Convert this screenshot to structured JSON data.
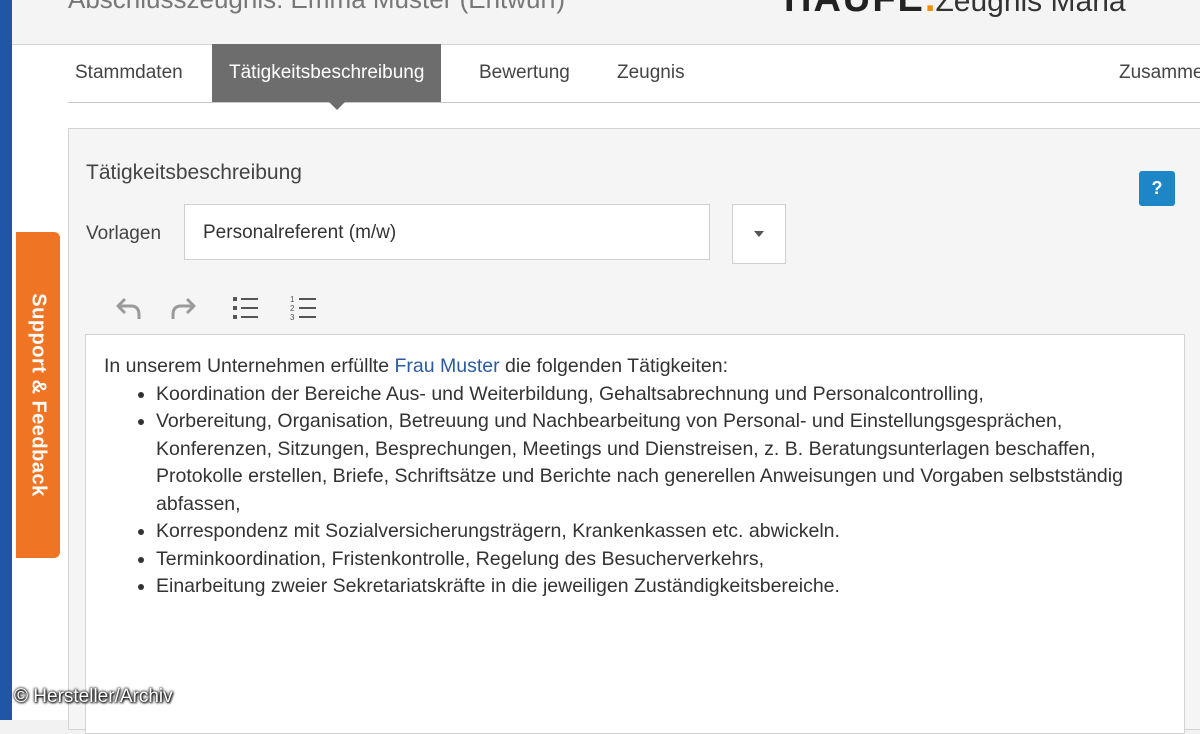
{
  "header": {
    "document_title": "Abschlusszeugnis: Emma Muster (Entwurf)",
    "brand_strong": "HAUFE",
    "brand_dot": ".",
    "brand_sub": "Zeugnis Mana"
  },
  "tabs": [
    {
      "label": "Stammdaten",
      "active": false
    },
    {
      "label": "Tätigkeitsbeschreibung",
      "active": true
    },
    {
      "label": "Bewertung",
      "active": false
    },
    {
      "label": "Zeugnis",
      "active": false
    },
    {
      "label": "Zusamme",
      "active": false
    }
  ],
  "panel": {
    "title": "Tätigkeitsbeschreibung",
    "help_label": "?",
    "vorlagen_label": "Vorlagen",
    "vorlagen_value": "Personalreferent (m/w)"
  },
  "toolbar": {
    "icons": [
      "undo-icon",
      "redo-icon",
      "bullet-list-icon",
      "numbered-list-icon"
    ]
  },
  "editor": {
    "intro_before": "In unserem Unternehmen erfüllte ",
    "intro_name": "Frau Muster",
    "intro_after": " die folgenden Tätigkeiten:",
    "items": [
      "Koordination der Bereiche Aus- und Weiterbildung, Gehaltsabrechnung und Personalcontrolling,",
      "Vorbereitung, Organisation, Betreuung und Nachbearbeitung von Personal- und Einstellungsgesprächen, Konferenzen, Sitzungen, Besprechungen, Meetings und Dienstreisen, z. B. Beratungsunterlagen beschaffen, Protokolle erstellen, Briefe, Schriftsätze und Berichte nach generellen Anweisungen und Vorgaben selbstständig abfassen,",
      "Korrespondenz mit Sozialversicherungsträgern, Krankenkassen etc. abwickeln.",
      "Terminkoordination, Fristenkontrolle, Regelung des Besucherverkehrs,",
      "Einarbeitung zweier Sekretariatskräfte in die jeweiligen Zuständigkeitsbereiche."
    ]
  },
  "support_label": "Support & Feedback",
  "credit": "© Hersteller/Archiv",
  "colors": {
    "accent_blue": "#1d86c7",
    "active_tab": "#6d6d6d",
    "support_orange": "#ef7424",
    "left_edge": "#1f56a6"
  }
}
